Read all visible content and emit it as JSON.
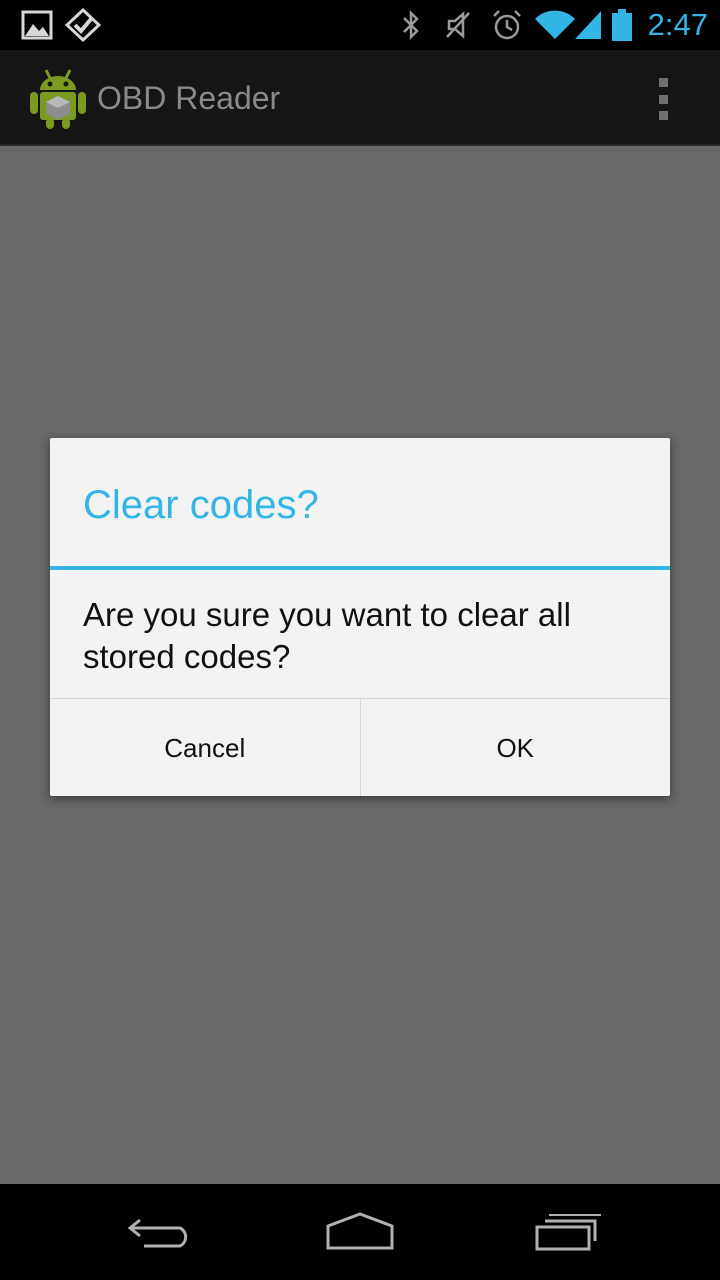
{
  "status_bar": {
    "time": "2:47",
    "left_icons": [
      "gallery-icon",
      "foursquare-icon"
    ],
    "right_icons": [
      "bluetooth-icon",
      "muted-icon",
      "alarm-icon",
      "wifi-icon",
      "signal-icon",
      "battery-icon"
    ]
  },
  "action_bar": {
    "title": "OBD Reader",
    "menu_icon": "overflow-menu-icon"
  },
  "dialog": {
    "title": "Clear codes?",
    "message": "Are you sure you want to clear all stored codes?",
    "cancel_label": "Cancel",
    "ok_label": "OK"
  },
  "nav_bar": {
    "icons": [
      "back-icon",
      "home-icon",
      "recent-apps-icon"
    ]
  },
  "colors": {
    "accent": "#33b5e5",
    "dim_overlay": "#686868",
    "dialog_bg": "#f3f3f3"
  }
}
